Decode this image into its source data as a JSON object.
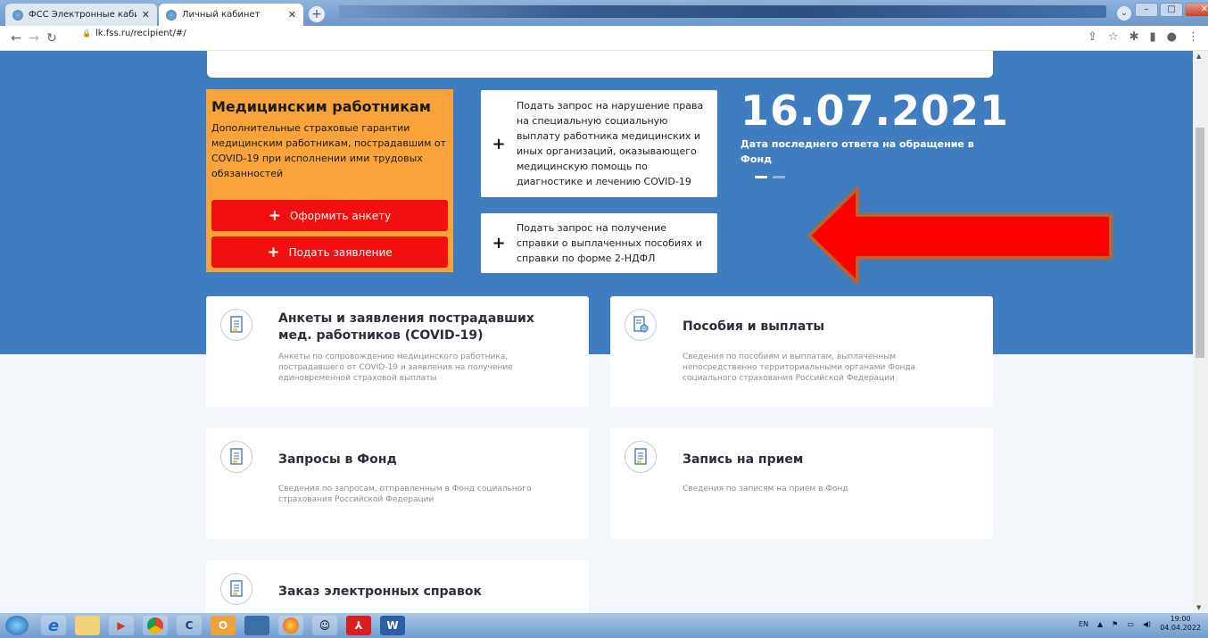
{
  "browser": {
    "tabs": [
      {
        "label": "ФСС Электронные кабинеты",
        "active": false
      },
      {
        "label": "Личный кабинет",
        "active": true
      }
    ],
    "url": "lk.fss.ru/recipient/#/"
  },
  "medical": {
    "title": "Медицинским работникам",
    "description": "Дополнительные страховые гарантии медицинским работникам, пострадавшим от COVID-19 при исполнении ими трудовых обязанностей",
    "btn_form": "Оформить анкету",
    "btn_apply": "Подать заявление"
  },
  "requests": {
    "violation": "Подать запрос на нарушение права на специальную социальную выплату работника медицинских и иных организаций, оказывающего медицинскую помощь по диагностике и лечению COVID-19",
    "certificate": "Подать запрос на получение справки о выплаченных пособиях и справки по форме 2-НДФЛ"
  },
  "last_answer": {
    "date": "16.07.2021",
    "caption": "Дата последнего ответа на обращение в Фонд"
  },
  "cards": [
    {
      "title": "Анкеты и заявления пострадавших мед. работников (COVID-19)",
      "desc": "Анкеты по сопровождению медицинского работника, пострадавшего от COVID-19 и заявления на получение единовременной страховой выплаты"
    },
    {
      "title": "Пособия и выплаты",
      "desc": "Сведения по пособиям и выплатам, выплаченным непосредственно территориальными органами Фонда социального страхования Российской Федерации"
    },
    {
      "title": "Запросы в Фонд",
      "desc": "Сведения по запросам, отправленным в Фонд социального страхования Российской Федерации"
    },
    {
      "title": "Запись на прием",
      "desc": "Сведения по записям на прием в Фонд"
    },
    {
      "title": "Заказ электронных справок",
      "desc": ""
    }
  ],
  "taskbar": {
    "lang": "EN",
    "time": "19:00",
    "date": "04.04.2022"
  },
  "colors": {
    "hero": "#3f7dc0",
    "orange_card": "#f8a43a",
    "red_button": "#f20f0f",
    "arrow": "#ff0000"
  }
}
